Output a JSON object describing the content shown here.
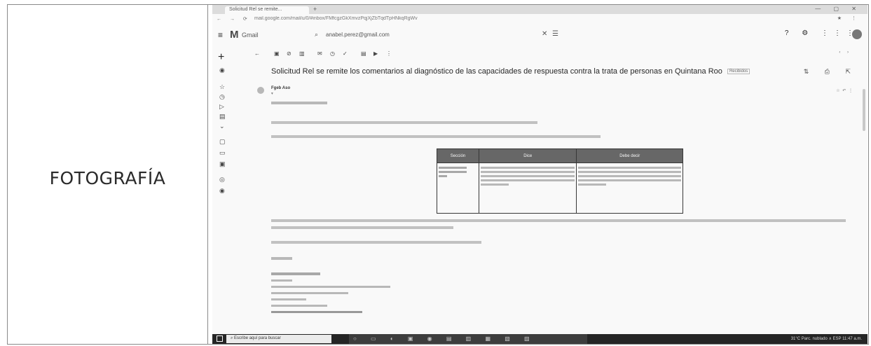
{
  "side_label": "FOTOGRAFÍA",
  "browser": {
    "tab_title": "Solicitud Rel se remite...",
    "new_tab": "+",
    "window_controls": "— ▢ ✕",
    "url": "mail.google.com/mail/u/0/#inbox/FMfcgzGkXmvzPqjXjZbTqdTpHNkqRgWv"
  },
  "gmail": {
    "logo": "M",
    "app_name": "Gmail",
    "search_value": "anabel.perez@gmail.com"
  },
  "message": {
    "subject": "Solicitud Rel se remite los comentarios al diagnóstico de las capacidades de respuesta contra la trata de personas en Quintana Roo",
    "tag": "Recibidos",
    "sender": "Fgeb Aso"
  },
  "table": {
    "headers": [
      "Sección",
      "Dice",
      "Debe decir"
    ]
  },
  "taskbar": {
    "search_placeholder": "Escribe aquí para buscar",
    "tray": "31°C Parc. nublado ∧ ESP 11:47 a.m."
  }
}
